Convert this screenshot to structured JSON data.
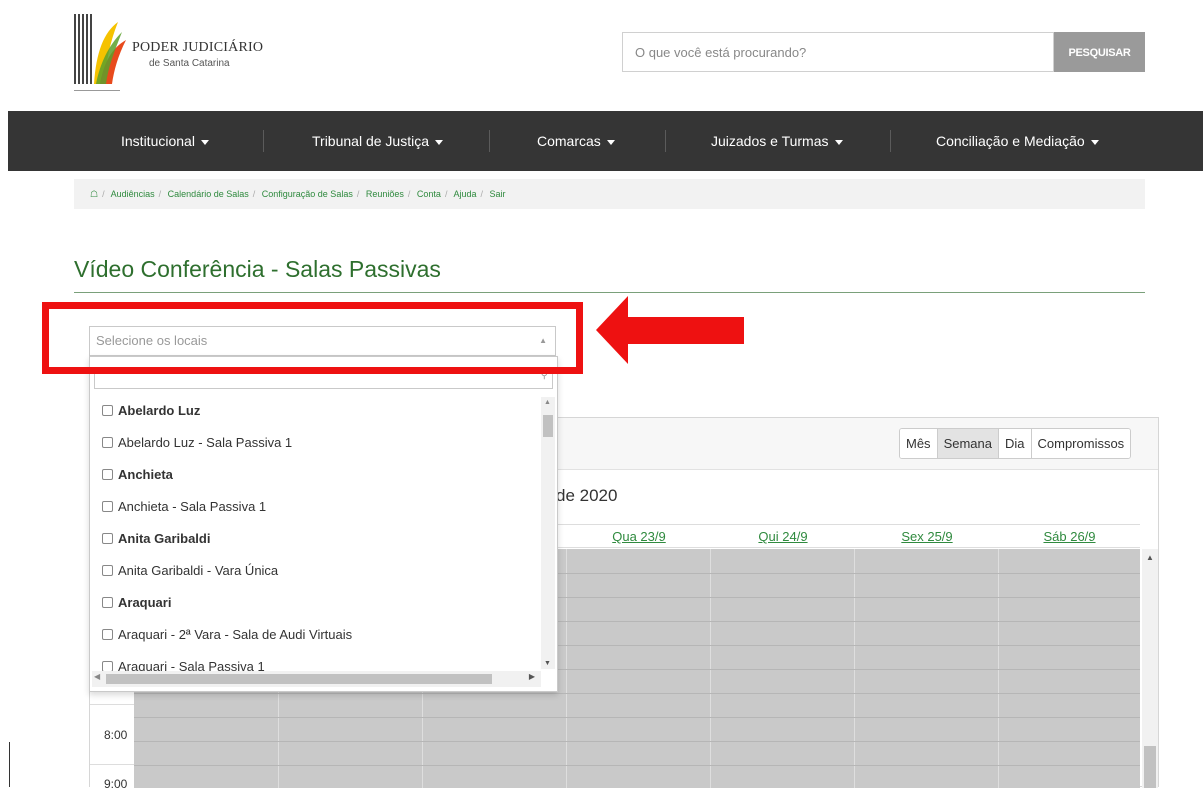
{
  "header": {
    "logo_line1": "PODER JUDICIÁRIO",
    "logo_line2": "de Santa Catarina",
    "search_placeholder": "O que você está procurando?",
    "search_button": "PESQUISAR"
  },
  "nav": {
    "items": [
      {
        "label": "Institucional"
      },
      {
        "label": "Tribunal de Justiça"
      },
      {
        "label": "Comarcas"
      },
      {
        "label": "Juizados e Turmas"
      },
      {
        "label": "Conciliação e Mediação"
      }
    ]
  },
  "breadcrumb": {
    "items": [
      "Audiências",
      "Calendário de Salas",
      "Configuração de Salas",
      "Reuniões",
      "Conta",
      "Ajuda",
      "Sair"
    ]
  },
  "page": {
    "title": "Vídeo Conferência - Salas Passivas"
  },
  "select": {
    "placeholder": "Selecione os locais",
    "search_value": "",
    "options": [
      {
        "label": "Abelardo Luz",
        "bold": true
      },
      {
        "label": "Abelardo Luz - Sala Passiva 1",
        "bold": false
      },
      {
        "label": "Anchieta",
        "bold": true
      },
      {
        "label": "Anchieta - Sala Passiva 1",
        "bold": false
      },
      {
        "label": "Anita Garibaldi",
        "bold": true
      },
      {
        "label": "Anita Garibaldi - Vara Única",
        "bold": false
      },
      {
        "label": "Araquari",
        "bold": true
      },
      {
        "label": "Araquari - 2ª Vara - Sala de Audi Virtuais",
        "bold": false
      },
      {
        "label": "Araquari - Sala Passiva 1",
        "bold": false
      }
    ]
  },
  "calendar": {
    "views": [
      "Mês",
      "Semana",
      "Dia",
      "Compromissos"
    ],
    "active_view": "Semana",
    "title_fragment": "de 2020",
    "days": [
      "Qua 23/9",
      "Qui 24/9",
      "Sex 25/9",
      "Sáb 26/9"
    ],
    "times": [
      "8:00",
      "9:00"
    ]
  },
  "colors": {
    "nav_bg": "#353535",
    "accent_green": "#2f8a3e",
    "highlight_red": "#ee1111"
  }
}
